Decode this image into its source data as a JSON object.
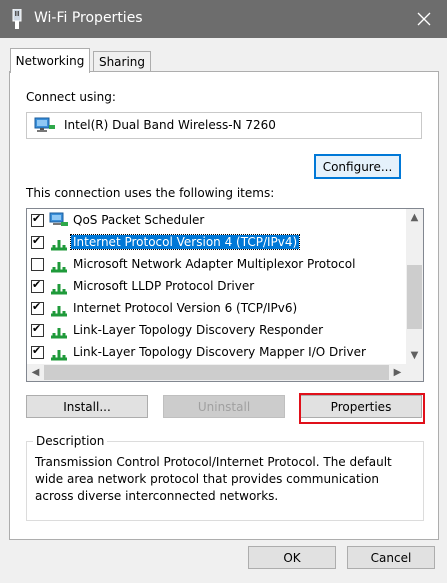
{
  "window": {
    "title": "Wi-Fi Properties"
  },
  "tabs": [
    {
      "label": "Networking"
    },
    {
      "label": "Sharing"
    }
  ],
  "connect_using": {
    "label": "Connect using:",
    "adapter": "Intel(R) Dual Band Wireless-N 7260"
  },
  "buttons": {
    "configure": "Configure...",
    "install": "Install...",
    "uninstall": "Uninstall",
    "properties": "Properties",
    "ok": "OK",
    "cancel": "Cancel"
  },
  "items_label": "This connection uses the following items:",
  "items": [
    {
      "name": "QoS Packet Scheduler",
      "checked": true
    },
    {
      "name": "Internet Protocol Version 4 (TCP/IPv4)",
      "checked": true,
      "selected": true
    },
    {
      "name": "Microsoft Network Adapter Multiplexor Protocol",
      "checked": false
    },
    {
      "name": "Microsoft LLDP Protocol Driver",
      "checked": true
    },
    {
      "name": "Internet Protocol Version 6 (TCP/IPv6)",
      "checked": true
    },
    {
      "name": "Link-Layer Topology Discovery Responder",
      "checked": true
    },
    {
      "name": "Link-Layer Topology Discovery Mapper I/O Driver",
      "checked": true
    }
  ],
  "description": {
    "title": "Description",
    "text": "Transmission Control Protocol/Internet Protocol. The default wide area network protocol that provides communication across diverse interconnected networks."
  },
  "colors": {
    "titlebar": "#6d6d6d",
    "selection": "#0078d7",
    "highlight": "#e0101a"
  }
}
